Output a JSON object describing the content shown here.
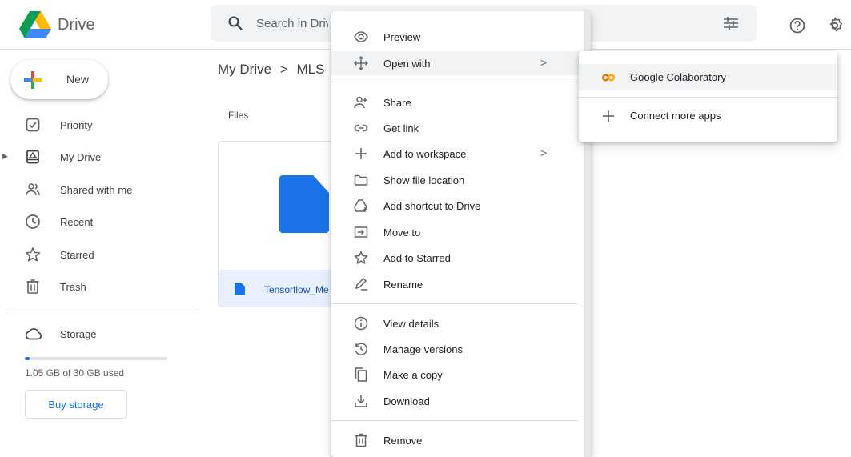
{
  "header": {
    "app_title": "Drive",
    "search_placeholder": "Search in Drive",
    "icons": [
      "drive-logo",
      "search-icon",
      "tune-icon",
      "help-icon",
      "settings-icon"
    ]
  },
  "sidebar": {
    "new_label": "New",
    "items": [
      {
        "label": "Priority",
        "icon": "priority-icon"
      },
      {
        "label": "My Drive",
        "icon": "my-drive-icon"
      },
      {
        "label": "Shared with me",
        "icon": "shared-icon"
      },
      {
        "label": "Recent",
        "icon": "clock-icon"
      },
      {
        "label": "Starred",
        "icon": "star-icon"
      },
      {
        "label": "Trash",
        "icon": "trash-icon"
      },
      {
        "label": "Storage",
        "icon": "cloud-icon"
      }
    ],
    "storage_text": "1.05 GB of 30 GB used",
    "storage_used_fraction": 0.035,
    "buy_storage": "Buy storage"
  },
  "main": {
    "breadcrumb": [
      "My Drive",
      ">",
      "MLS"
    ],
    "section_label": "Files",
    "file_name": "Tensorflow_Me"
  },
  "context_menu": {
    "items": [
      {
        "label": "Preview",
        "icon": "eye-icon"
      },
      {
        "label": "Open with",
        "icon": "move-arrows-icon",
        "submenu": ">"
      },
      {
        "label": "Share",
        "icon": "person-add-icon"
      },
      {
        "label": "Get link",
        "icon": "link-icon"
      },
      {
        "label": "Add to workspace",
        "icon": "plus-icon",
        "submenu": ">"
      },
      {
        "label": "Show file location",
        "icon": "folder-icon"
      },
      {
        "label": "Add shortcut to Drive",
        "icon": "shortcut-icon"
      },
      {
        "label": "Move to",
        "icon": "move-to-icon"
      },
      {
        "label": "Add to Starred",
        "icon": "star-icon"
      },
      {
        "label": "Rename",
        "icon": "pencil-icon"
      },
      {
        "label": "View details",
        "icon": "info-icon"
      },
      {
        "label": "Manage versions",
        "icon": "history-icon"
      },
      {
        "label": "Make a copy",
        "icon": "copy-icon"
      },
      {
        "label": "Download",
        "icon": "download-icon"
      },
      {
        "label": "Remove",
        "icon": "trash-icon"
      }
    ]
  },
  "submenu": {
    "items": [
      {
        "label": "Google Colaboratory",
        "icon": "colab-icon"
      },
      {
        "label": "Connect more apps",
        "icon": "plus-icon"
      }
    ]
  },
  "colors": {
    "accent": "#1a73e8",
    "selected_bg": "#e8f0fe",
    "hover_bg": "#f1f3f4",
    "colab_orange": "#f9ab00"
  }
}
